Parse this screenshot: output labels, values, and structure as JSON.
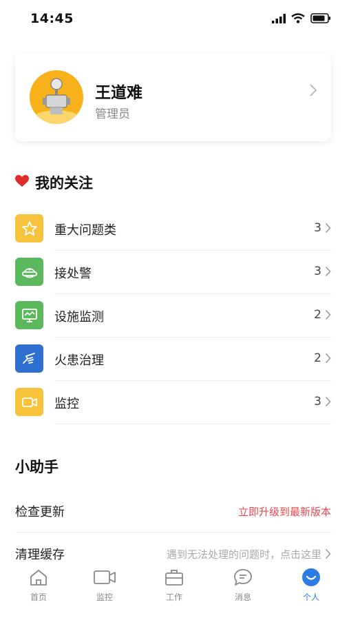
{
  "status_bar": {
    "time": "14:45"
  },
  "profile": {
    "name": "王道难",
    "role": "管理员"
  },
  "favorites": {
    "title": "我的关注",
    "items": [
      {
        "label": "重大问题类",
        "count": "3",
        "icon": "star-icon",
        "color": "#f7c23c"
      },
      {
        "label": "接处警",
        "count": "3",
        "icon": "alarm-icon",
        "color": "#5cb85c"
      },
      {
        "label": "设施监测",
        "count": "2",
        "icon": "monitor-icon",
        "color": "#5cb85c"
      },
      {
        "label": "火患治理",
        "count": "2",
        "icon": "hand-icon",
        "color": "#2f6fcf"
      },
      {
        "label": "监控",
        "count": "3",
        "icon": "camera-icon",
        "color": "#f7c23c"
      }
    ]
  },
  "helper": {
    "title": "小助手",
    "items": [
      {
        "label": "检查更新",
        "value": "立即升级到最新版本",
        "value_color": "#e8474f"
      },
      {
        "label": "清理缓存",
        "value": "遇到无法处理的问题时，点击这里",
        "value_color": "#aaaaaa"
      }
    ]
  },
  "tabs": [
    {
      "label": "首页",
      "icon": "home-icon",
      "active": false
    },
    {
      "label": "监控",
      "icon": "video-icon",
      "active": false
    },
    {
      "label": "工作",
      "icon": "briefcase-icon",
      "active": false
    },
    {
      "label": "消息",
      "icon": "message-icon",
      "active": false
    },
    {
      "label": "个人",
      "icon": "person-icon",
      "active": true
    }
  ],
  "colors": {
    "accent": "#2d7be5",
    "heart": "#e02b2b",
    "avatar_bg": "#f7b21b"
  }
}
